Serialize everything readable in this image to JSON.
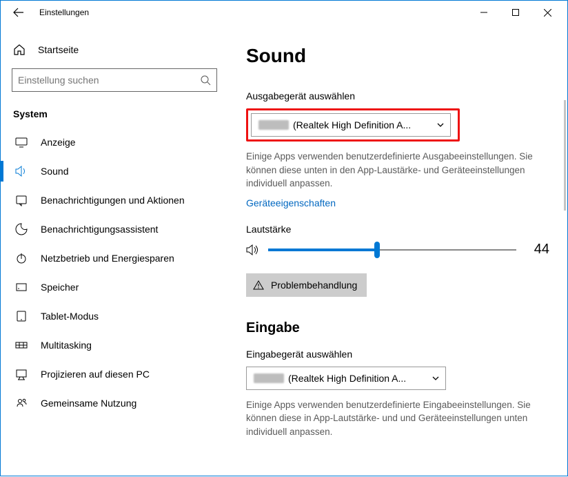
{
  "window": {
    "title": "Einstellungen"
  },
  "sidebar": {
    "home": "Startseite",
    "search_placeholder": "Einstellung suchen",
    "category": "System",
    "items": [
      {
        "label": "Anzeige",
        "icon": "display-icon"
      },
      {
        "label": "Sound",
        "icon": "sound-icon",
        "active": true
      },
      {
        "label": "Benachrichtigungen und Aktionen",
        "icon": "notifications-icon"
      },
      {
        "label": "Benachrichtigungsassistent",
        "icon": "focus-assist-icon"
      },
      {
        "label": "Netzbetrieb und Energiesparen",
        "icon": "power-icon"
      },
      {
        "label": "Speicher",
        "icon": "storage-icon"
      },
      {
        "label": "Tablet-Modus",
        "icon": "tablet-icon"
      },
      {
        "label": "Multitasking",
        "icon": "multitasking-icon"
      },
      {
        "label": "Projizieren auf diesen PC",
        "icon": "project-icon"
      },
      {
        "label": "Gemeinsame Nutzung",
        "icon": "shared-icon"
      }
    ]
  },
  "main": {
    "title": "Sound",
    "output": {
      "label": "Ausgabegerät auswählen",
      "selected": "(Realtek High Definition A...",
      "desc": "Einige Apps verwenden benutzerdefinierte Ausgabeeinstellungen. Sie können diese unten in den App-Laustärke- und Geräteeinstellungen individuell anpassen.",
      "props_link": "Geräteeigenschaften",
      "volume_label": "Lautstärke",
      "volume": 44,
      "troubleshoot": "Problembehandlung"
    },
    "input": {
      "heading": "Eingabe",
      "label": "Eingabegerät auswählen",
      "selected": "(Realtek High Definition A...",
      "desc": "Einige Apps verwenden benutzerdefinierte Eingabeeinstellungen. Sie können diese in App-Lautstärke- und und Geräteeinstellungen unten individuell anpassen."
    }
  }
}
